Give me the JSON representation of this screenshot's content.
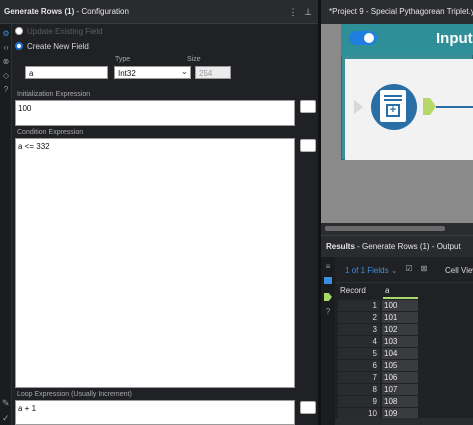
{
  "left_panel": {
    "title_bold": "Generate Rows (1)",
    "title_rest": " - Configuration",
    "header_icons": [
      "more-icon",
      "pin-icon"
    ],
    "rail_icons": [
      "gear-icon",
      "code-icon",
      "tag-icon",
      "question-icon"
    ],
    "radio_update": "Update Existing Field",
    "radio_create": "Create New Field",
    "field_name": "a",
    "type_label": "Type",
    "type_value": "Int32",
    "size_label": "Size",
    "size_value": "254",
    "init_label": "Initialization Expression",
    "init_value": "100",
    "cond_label": "Condition Expression",
    "cond_value": "a <= 332",
    "loop_label": "Loop Expression (Usually Increment)",
    "loop_value": "a + 1",
    "bottom_icons": [
      "pencil-icon",
      "checkmark-icon"
    ]
  },
  "canvas": {
    "tab_title": "*Project 9 - Special Pythagorean Triplet.y...",
    "container_title": "Input",
    "toggle_on": true
  },
  "results": {
    "title_bold": "Results",
    "title_rest": " - Generate Rows (1) - Output",
    "fields_label": "1 of 1 Fields",
    "cell_view_label": "Cell View",
    "col_record": "Record",
    "col_a": "a",
    "rows": [
      {
        "record": "1",
        "a": "100"
      },
      {
        "record": "2",
        "a": "101"
      },
      {
        "record": "3",
        "a": "102"
      },
      {
        "record": "4",
        "a": "103"
      },
      {
        "record": "5",
        "a": "104"
      },
      {
        "record": "6",
        "a": "105"
      },
      {
        "record": "7",
        "a": "106"
      },
      {
        "record": "8",
        "a": "107"
      },
      {
        "record": "9",
        "a": "108"
      },
      {
        "record": "10",
        "a": "109"
      }
    ]
  }
}
